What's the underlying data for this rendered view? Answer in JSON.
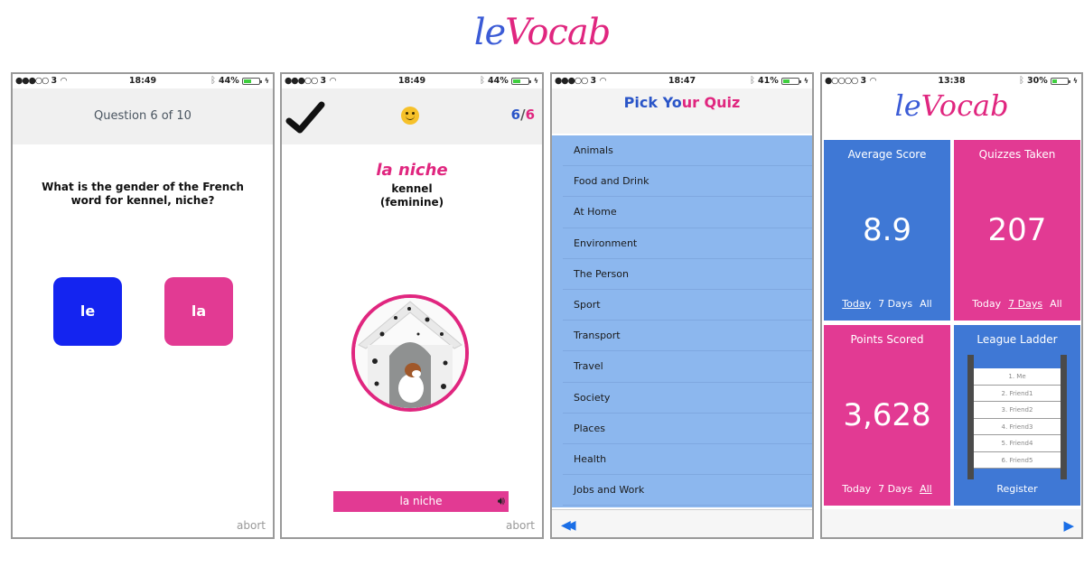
{
  "brand": {
    "logo_le": "le",
    "logo_vocab": "Vocab"
  },
  "colors": {
    "blue": "#3f78d5",
    "pink": "#e23a93",
    "answer_le": "#1424f0",
    "list_bg": "#8cb7ee"
  },
  "screens": [
    {
      "status": {
        "carrier": "3",
        "time": "18:49",
        "battery": "44%",
        "battery_level": 0.44
      },
      "header": "Question 6 of 10",
      "question": "What is the gender of the French word for kennel, niche?",
      "answers": [
        "le",
        "la"
      ],
      "abort": "abort"
    },
    {
      "status": {
        "carrier": "3",
        "time": "18:49",
        "battery": "44%",
        "battery_level": 0.44
      },
      "result_icon": "checkmark-icon",
      "mood_icon": "smiley-icon",
      "score_correct": "6",
      "score_sep": "/",
      "score_total": "6",
      "word": "la niche",
      "translation": "kennel",
      "gender": "(feminine)",
      "image": "dog-in-kennel",
      "audio_label": "la niche",
      "abort": "abort"
    },
    {
      "status": {
        "carrier": "3",
        "time": "18:47",
        "battery": "41%",
        "battery_level": 0.41
      },
      "title_part1": "Pick Yo",
      "title_part2": "ur Quiz",
      "quizzes": [
        "Animals",
        "Food and Drink",
        "At Home",
        "Environment",
        "The Person",
        "Sport",
        "Transport",
        "Travel",
        "Society",
        "Places",
        "Health",
        "Jobs and Work"
      ]
    },
    {
      "status": {
        "carrier": "3",
        "time": "13:38",
        "battery": "30%",
        "battery_level": 0.3
      },
      "tiles": [
        {
          "title": "Average Score",
          "value": "8.9",
          "periods": [
            "Today",
            "7 Days",
            "All"
          ],
          "selected": 0
        },
        {
          "title": "Quizzes Taken",
          "value": "207",
          "periods": [
            "Today",
            "7 Days",
            "All"
          ],
          "selected": 1
        },
        {
          "title": "Points Scored",
          "value": "3,628",
          "periods": [
            "Today",
            "7 Days",
            "All"
          ],
          "selected": 2
        },
        {
          "title": "League Ladder",
          "ladder": [
            "1. Me",
            "2. Friend1",
            "3. Friend2",
            "4. Friend3",
            "5. Friend4",
            "6. Friend5"
          ],
          "action": "Register"
        }
      ]
    }
  ]
}
